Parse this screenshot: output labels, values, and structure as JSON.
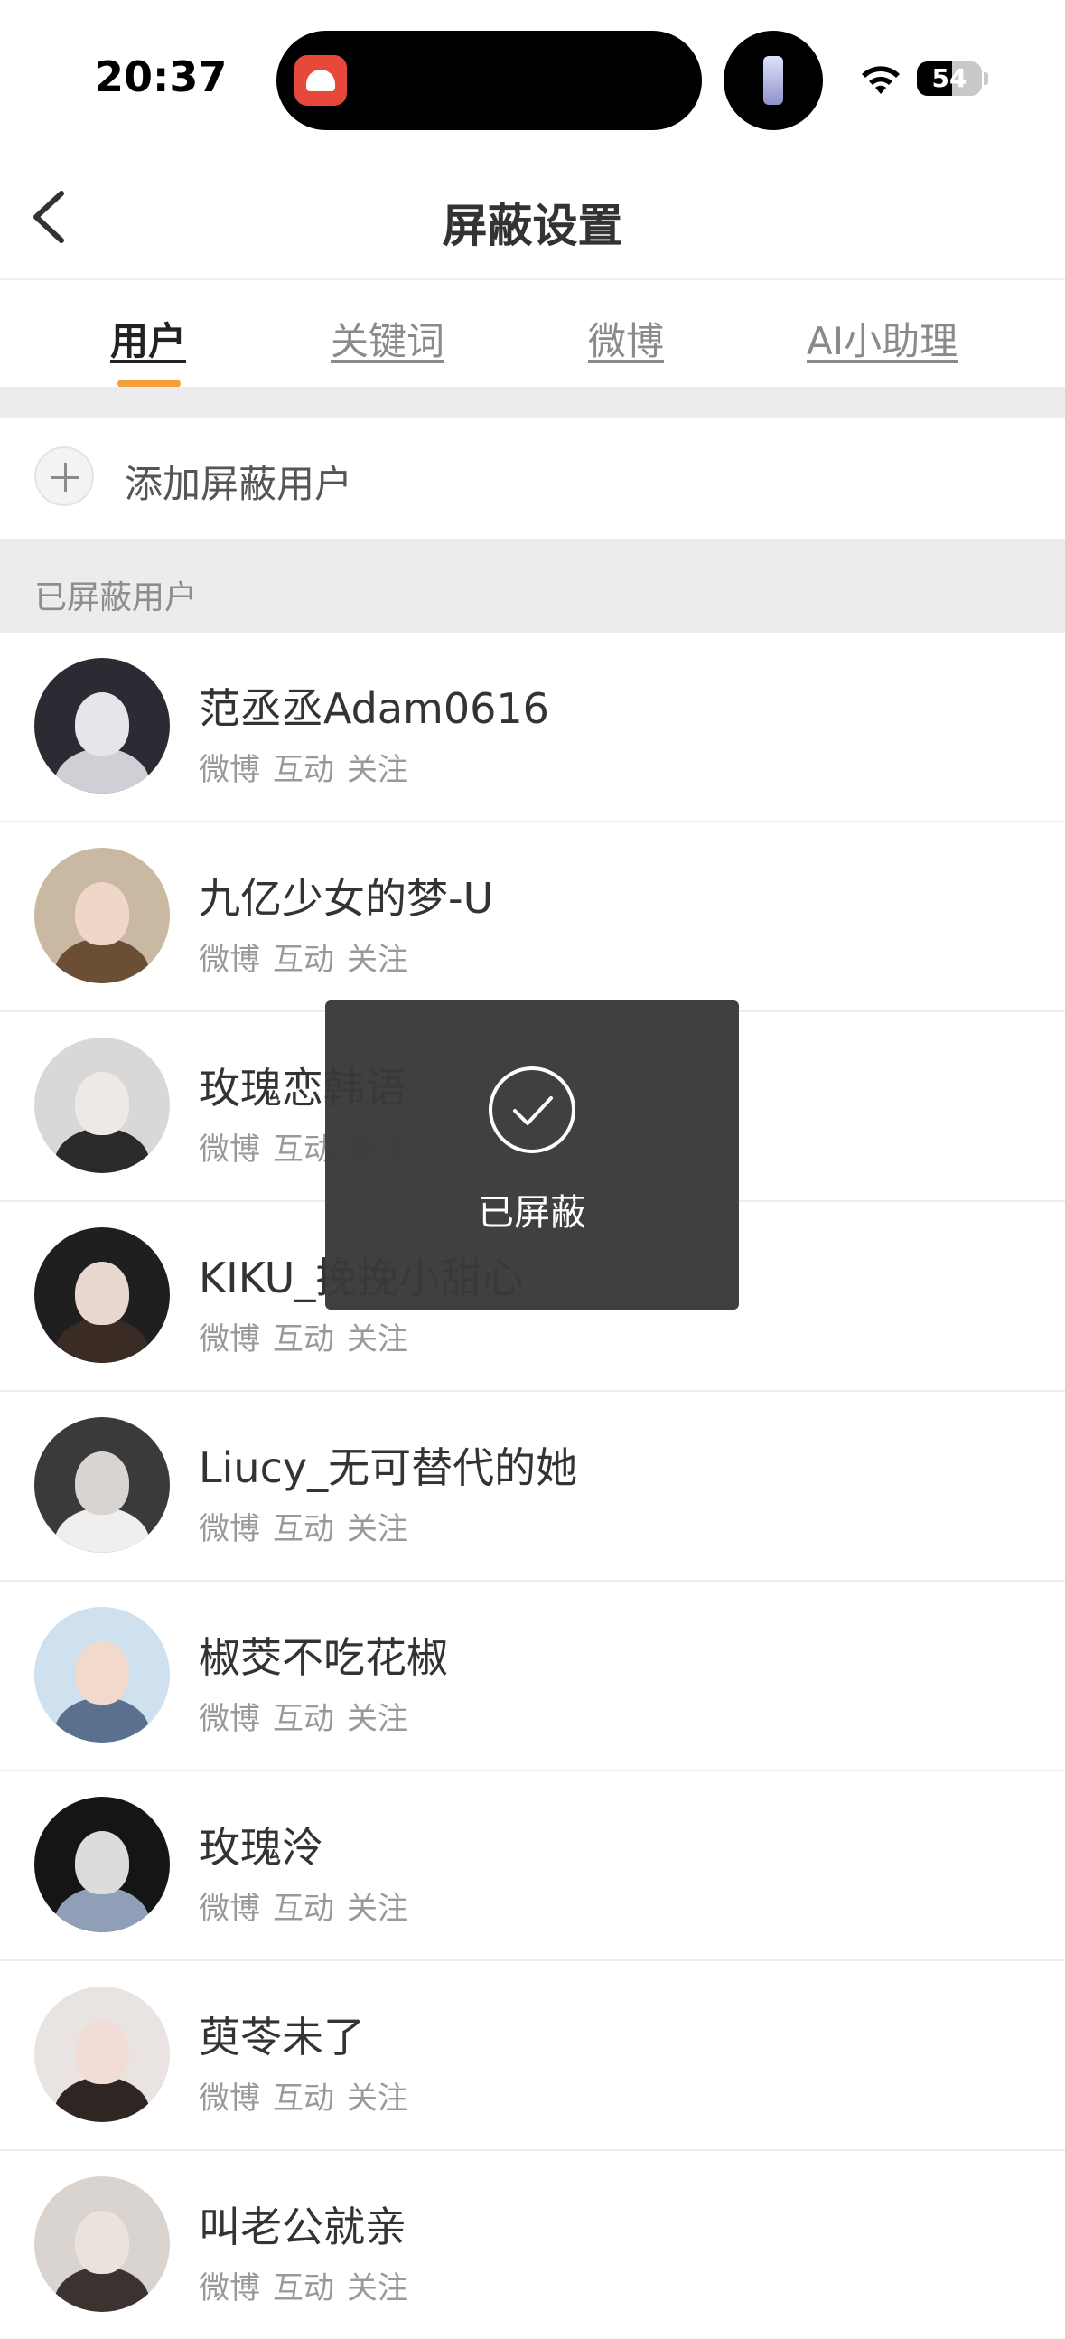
{
  "status_bar": {
    "time": "20:37",
    "battery_level": "54",
    "battery_fraction": 0.54,
    "icons": [
      "app-activity-icon",
      "flashlight-icon",
      "wifi-icon",
      "battery-icon"
    ]
  },
  "nav": {
    "title": "屏蔽设置",
    "back_icon": "chevron-left-icon"
  },
  "tabs": [
    {
      "label": "用户",
      "active": true
    },
    {
      "label": "关键词",
      "active": false
    },
    {
      "label": "微博",
      "active": false
    },
    {
      "label": "AI小助理",
      "active": false
    }
  ],
  "colors": {
    "accent": "#f3a03c",
    "section_bg": "#ececec",
    "toast_bg": "#3a3a3a"
  },
  "add_row": {
    "label": "添加屏蔽用户",
    "icon": "plus-icon"
  },
  "section_header": "已屏蔽用户",
  "users": [
    {
      "name": "范丞丞Adam0616",
      "meta": [
        "微博",
        "互动",
        "关注"
      ],
      "avatar_colors": [
        "#2b2b33",
        "#e6e6ea",
        "#cfd0d6"
      ]
    },
    {
      "name": "九亿少女的梦-U",
      "meta": [
        "微博",
        "互动",
        "关注"
      ],
      "avatar_colors": [
        "#c9b9a2",
        "#f0d6c8",
        "#6b4f35"
      ]
    },
    {
      "name": "玫瑰恋韩语",
      "meta": [
        "微博",
        "互动",
        "关注"
      ],
      "avatar_colors": [
        "#d8d8d8",
        "#efe9e6",
        "#2a2a2a"
      ]
    },
    {
      "name": "KIKU_挽挽小甜心",
      "meta": [
        "微博",
        "互动",
        "关注"
      ],
      "avatar_colors": [
        "#1f1f1f",
        "#e9d8cf",
        "#3a2b25"
      ]
    },
    {
      "name": "Liucy_无可替代的她",
      "meta": [
        "微博",
        "互动",
        "关注"
      ],
      "avatar_colors": [
        "#3a3a3a",
        "#d9d4d0",
        "#efefef"
      ]
    },
    {
      "name": "椒茭不吃花椒",
      "meta": [
        "微博",
        "互动",
        "关注"
      ],
      "avatar_colors": [
        "#cfe0ee",
        "#f1d9cc",
        "#5b6f8e"
      ]
    },
    {
      "name": "玫瑰泠",
      "meta": [
        "微博",
        "互动",
        "关注"
      ],
      "avatar_colors": [
        "#151515",
        "#dcdcdc",
        "#8f9fb8"
      ]
    },
    {
      "name": "萸苓未了",
      "meta": [
        "微博",
        "互动",
        "关注"
      ],
      "avatar_colors": [
        "#e9e4e2",
        "#f2ddd6",
        "#2f2522"
      ]
    },
    {
      "name": "叫老公就亲",
      "meta": [
        "微博",
        "互动",
        "关注"
      ],
      "avatar_colors": [
        "#d9d4cf",
        "#ece2dc",
        "#3b3330"
      ]
    }
  ],
  "toast": {
    "text": "已屏蔽",
    "icon": "check-circle-icon"
  }
}
